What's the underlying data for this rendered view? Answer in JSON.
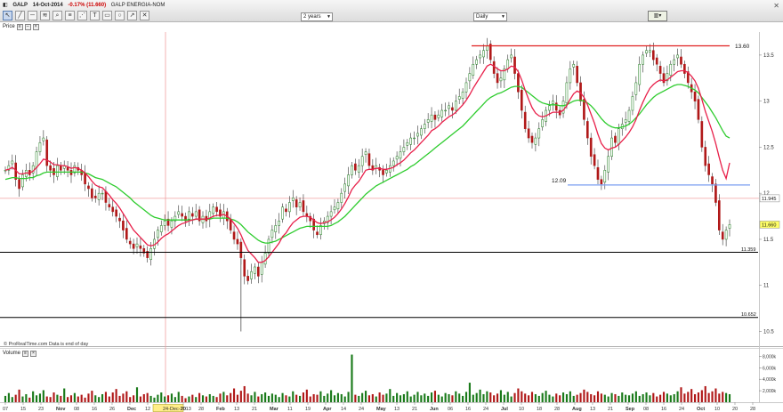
{
  "header": {
    "symbol": "GALP",
    "date": "14-Oct-2014",
    "change": "-0.17% (11.660)",
    "name": "GALP ENERGIA-NOM",
    "period_select": "2 years",
    "interval_select": "Daily"
  },
  "panels": {
    "price_label": "Price",
    "volume_label": "Volume",
    "source_note": "© ProRealTime.com  Data is end of day"
  },
  "colors": {
    "price_up": "#1a7a1a",
    "price_down": "#b01818",
    "ema_short": "#e8204a",
    "ema_long": "#2ecc2e",
    "resistance": "#e02020",
    "support": "#7a9ef0",
    "crosshair": "#f0a0a0",
    "hline": "#000000"
  },
  "chart_data": [
    {
      "type": "candlestick",
      "title": "",
      "ylim": [
        10.35,
        13.75
      ],
      "yticks": [
        10.5,
        11,
        11.5,
        12,
        12.5,
        13,
        13.5
      ],
      "x_tick_labels": [
        "07",
        "15",
        "23",
        "Nov",
        "08",
        "16",
        "26",
        "Dec",
        "12",
        "24-Dec-2013",
        "20",
        "28",
        "Feb",
        "13",
        "21",
        "Mar",
        "11",
        "19",
        "Apr",
        "14",
        "24",
        "May",
        "13",
        "21",
        "Jun",
        "06",
        "16",
        "24",
        "Jul",
        "10",
        "18",
        "28",
        "Aug",
        "13",
        "21",
        "Sep",
        "08",
        "16",
        "24",
        "Oct",
        "10",
        "20",
        "28"
      ],
      "crosshair_date": "24-Dec-2013",
      "crosshair_price": 11.945,
      "last_price": 11.66,
      "annotations": [
        {
          "label": "13.60",
          "value": 13.6,
          "kind": "resistance"
        },
        {
          "label": "12.09",
          "value": 12.09,
          "kind": "support"
        },
        {
          "label": "11.359",
          "value": 11.359,
          "kind": "hline"
        },
        {
          "label": "10.652",
          "value": 10.652,
          "kind": "hline"
        }
      ],
      "price_tags": [
        {
          "label": "11.945",
          "value": 11.945
        },
        {
          "label": "11.660",
          "value": 11.66
        }
      ],
      "grid": false,
      "series": [
        {
          "values": [
            12.25,
            12.3,
            12.35,
            12.15,
            12.05,
            12.2,
            12.25,
            12.2,
            12.3,
            12.45,
            12.55,
            12.6,
            12.3,
            12.25,
            12.2,
            12.3,
            12.25,
            12.3,
            12.25,
            12.2,
            12.3,
            12.25,
            12.2,
            12.1,
            12.05,
            11.95,
            11.95,
            12.0,
            12.0,
            11.9,
            11.85,
            11.8,
            11.75,
            11.7,
            11.6,
            11.5,
            11.45,
            11.4,
            11.45,
            11.4,
            11.35,
            11.3,
            11.4,
            11.5,
            11.6,
            11.65,
            11.7,
            11.65,
            11.7,
            11.75,
            11.8,
            11.75,
            11.7,
            11.8,
            11.75,
            11.8,
            11.7,
            11.75,
            11.7,
            11.8,
            11.85,
            11.8,
            11.75,
            11.8,
            11.7,
            11.6,
            11.5,
            11.45,
            11.3,
            11.1,
            11.05,
            11.15,
            11.2,
            11.1,
            11.25,
            11.35,
            11.5,
            11.6,
            11.65,
            11.7,
            11.85,
            11.8,
            11.9,
            11.95,
            11.85,
            11.9,
            11.8,
            11.75,
            11.7,
            11.6,
            11.55,
            11.65,
            11.7,
            11.75,
            11.8,
            11.85,
            11.9,
            12.0,
            12.1,
            12.2,
            12.3,
            12.25,
            12.3,
            12.4,
            12.45,
            12.3,
            12.25,
            12.3,
            12.25,
            12.2,
            12.25,
            12.3,
            12.35,
            12.4,
            12.45,
            12.5,
            12.55,
            12.6,
            12.6,
            12.65,
            12.7,
            12.75,
            12.8,
            12.85,
            12.8,
            12.85,
            12.9,
            12.9,
            12.95,
            12.9,
            13.0,
            13.05,
            13.1,
            13.2,
            13.3,
            13.4,
            13.45,
            13.5,
            13.55,
            13.6,
            13.45,
            13.3,
            13.2,
            13.25,
            13.35,
            13.45,
            13.5,
            13.3,
            13.1,
            12.9,
            12.7,
            12.6,
            12.55,
            12.6,
            12.7,
            12.8,
            12.9,
            12.95,
            13.0,
            12.9,
            12.85,
            13.0,
            13.2,
            13.35,
            13.4,
            13.2,
            13.0,
            12.8,
            12.6,
            12.4,
            12.3,
            12.15,
            12.1,
            12.25,
            12.4,
            12.6,
            12.55,
            12.7,
            12.75,
            12.8,
            12.9,
            13.05,
            13.2,
            13.4,
            13.5,
            13.55,
            13.55,
            13.45,
            13.4,
            13.3,
            13.2,
            13.3,
            13.4,
            13.45,
            13.5,
            13.4,
            13.3,
            13.2,
            13.1,
            13.0,
            12.8,
            12.5,
            12.3,
            12.2,
            12.1,
            11.9,
            11.6,
            11.5,
            11.6,
            11.66
          ]
        },
        {
          "name": "",
          "values": [
            12.25,
            12.26,
            12.28,
            12.25,
            12.21,
            12.21,
            12.22,
            12.22,
            12.24,
            12.28,
            12.32,
            12.37,
            12.36,
            12.34,
            12.31,
            12.31,
            12.3,
            12.3,
            12.29,
            12.27,
            12.28,
            12.27,
            12.25,
            12.22,
            12.18,
            12.13,
            12.09,
            12.07,
            12.06,
            12.02,
            11.98,
            11.93,
            11.89,
            11.84,
            11.78,
            11.72,
            11.66,
            11.6,
            11.56,
            11.52,
            11.48,
            11.44,
            11.43,
            11.44,
            11.47,
            11.51,
            11.54,
            11.56,
            11.59,
            11.62,
            11.65,
            11.67,
            11.68,
            11.7,
            11.71,
            11.72,
            11.72,
            11.72,
            11.72,
            11.73,
            11.75,
            11.76,
            11.76,
            11.77,
            11.75,
            11.72,
            11.67,
            11.62,
            11.55,
            11.46,
            11.38,
            11.34,
            11.3,
            11.25,
            11.25,
            11.27,
            11.31,
            11.36,
            11.41,
            11.46,
            11.53,
            11.57,
            11.63,
            11.68,
            11.71,
            11.74,
            11.75,
            11.75,
            11.74,
            11.71,
            11.68,
            11.67,
            11.68,
            11.69,
            11.71,
            11.74,
            11.78,
            11.83,
            11.89,
            11.96,
            12.04,
            12.09,
            12.13,
            12.19,
            12.25,
            12.26,
            12.26,
            12.27,
            12.27,
            12.26,
            12.26,
            12.27,
            12.28,
            12.31,
            12.33,
            12.36,
            12.4,
            12.44,
            12.47,
            12.51,
            12.55,
            12.59,
            12.63,
            12.68,
            12.7,
            12.73,
            12.77,
            12.8,
            12.83,
            12.85,
            12.88,
            12.92,
            12.96,
            13.01,
            13.07,
            13.14,
            13.2,
            13.26,
            13.32,
            13.38,
            13.4,
            13.38,
            13.35,
            13.33,
            13.33,
            13.35,
            13.38,
            13.37,
            13.32,
            13.23,
            13.12,
            13.02,
            12.93,
            12.87,
            12.84,
            12.83,
            12.84,
            12.86,
            12.88,
            12.88,
            12.88,
            12.9,
            12.95,
            13.02,
            13.08,
            13.11,
            13.09,
            13.04,
            12.96,
            12.86,
            12.76,
            12.64,
            12.54,
            12.49,
            12.47,
            12.49,
            12.5,
            12.53,
            12.57,
            12.61,
            12.66,
            12.72,
            12.8,
            12.9,
            12.99,
            13.07,
            13.14,
            13.18,
            13.21,
            13.23,
            13.22,
            13.23,
            13.26,
            13.29,
            13.32,
            13.33,
            13.33,
            13.31,
            13.27,
            13.22,
            13.14,
            13.02,
            12.89,
            12.78,
            12.67,
            12.54,
            12.39,
            12.25,
            12.16,
            12.33
          ]
        },
        {
          "name": "",
          "values": [
            12.15,
            12.16,
            12.17,
            12.17,
            12.16,
            12.16,
            12.16,
            12.17,
            12.17,
            12.19,
            12.2,
            12.22,
            12.23,
            12.23,
            12.23,
            12.23,
            12.23,
            12.23,
            12.23,
            12.23,
            12.23,
            12.23,
            12.23,
            12.22,
            12.21,
            12.19,
            12.17,
            12.16,
            12.15,
            12.13,
            12.11,
            12.09,
            12.07,
            12.04,
            12.01,
            11.98,
            11.95,
            11.91,
            11.88,
            11.85,
            11.82,
            11.79,
            11.76,
            11.74,
            11.73,
            11.72,
            11.71,
            11.71,
            11.71,
            11.71,
            11.71,
            11.71,
            11.71,
            11.71,
            11.71,
            11.72,
            11.72,
            11.72,
            11.72,
            11.72,
            11.73,
            11.73,
            11.73,
            11.73,
            11.73,
            11.72,
            11.71,
            11.69,
            11.66,
            11.62,
            11.58,
            11.55,
            11.52,
            11.49,
            11.47,
            11.46,
            11.46,
            11.47,
            11.48,
            11.5,
            11.52,
            11.54,
            11.56,
            11.58,
            11.6,
            11.62,
            11.63,
            11.64,
            11.64,
            11.64,
            11.64,
            11.64,
            11.64,
            11.64,
            11.65,
            11.67,
            11.69,
            11.72,
            11.75,
            11.79,
            11.83,
            11.87,
            11.91,
            11.95,
            11.99,
            12.02,
            12.05,
            12.08,
            12.1,
            12.12,
            12.14,
            12.16,
            12.18,
            12.2,
            12.22,
            12.24,
            12.26,
            12.29,
            12.31,
            12.34,
            12.37,
            12.4,
            12.43,
            12.46,
            12.49,
            12.52,
            12.55,
            12.58,
            12.61,
            12.64,
            12.67,
            12.7,
            12.73,
            12.77,
            12.81,
            12.85,
            12.89,
            12.93,
            12.97,
            13.01,
            13.04,
            13.06,
            13.08,
            13.09,
            13.11,
            13.13,
            13.15,
            13.16,
            13.16,
            13.15,
            13.12,
            13.09,
            13.06,
            13.03,
            13.0,
            12.98,
            12.97,
            12.96,
            12.96,
            12.96,
            12.95,
            12.95,
            12.96,
            12.98,
            13.0,
            13.01,
            13.01,
            13.0,
            12.98,
            12.95,
            12.91,
            12.86,
            12.81,
            12.77,
            12.74,
            12.72,
            12.71,
            12.71,
            12.72,
            12.73,
            12.75,
            12.78,
            12.82,
            12.86,
            12.91,
            12.96,
            13.0,
            13.04,
            13.07,
            13.09,
            13.11,
            13.13,
            13.15,
            13.17,
            13.18,
            13.18,
            13.17,
            13.16,
            13.14,
            13.12,
            13.09,
            13.04,
            12.99,
            12.94,
            12.88,
            12.82,
            12.75,
            12.68,
            12.62,
            12.6
          ]
        }
      ]
    },
    {
      "type": "bar",
      "title": "",
      "ylim": [
        0,
        9000000
      ],
      "yticks": [
        2000000,
        4000000,
        6000000,
        8000000
      ],
      "ytick_labels": [
        "2,000k",
        "4,000k",
        "6,000k",
        "8,000k"
      ],
      "series": [
        {
          "values": [
            1.1,
            1.6,
            0.9,
            1.3,
            2.2,
            1.0,
            1.4,
            0.8,
            1.9,
            1.2,
            1.5,
            2.1,
            1.0,
            0.9,
            1.7,
            1.3,
            1.1,
            2.4,
            0.9,
            1.2,
            1.6,
            1.0,
            1.3,
            0.8,
            1.5,
            2.0,
            1.2,
            0.9,
            1.4,
            1.8,
            1.0,
            1.7,
            2.3,
            1.1,
            1.5,
            1.9,
            0.9,
            1.2,
            2.6,
            1.0,
            1.4,
            1.6,
            1.1,
            0.8,
            1.3,
            1.7,
            1.0,
            1.2,
            1.5,
            0.9,
            1.8,
            1.1,
            0.7,
            1.0,
            1.3,
            0.9,
            1.6,
            1.2,
            1.0,
            1.4,
            1.1,
            0.9,
            1.5,
            1.8,
            1.2,
            1.6,
            2.4,
            1.3,
            2.0,
            2.8,
            1.5,
            1.2,
            1.8,
            1.0,
            1.4,
            1.7,
            1.1,
            1.5,
            1.3,
            0.9,
            1.6,
            1.2,
            1.0,
            1.9,
            1.3,
            1.1,
            1.7,
            2.2,
            1.0,
            1.4,
            1.3,
            1.9,
            1.1,
            1.5,
            2.1,
            1.2,
            1.6,
            1.4,
            1.0,
            1.8,
            8.3,
            1.3,
            1.1,
            1.6,
            2.0,
            1.2,
            1.4,
            1.0,
            1.7,
            1.3,
            1.5,
            2.3,
            1.1,
            1.6,
            1.2,
            1.4,
            1.9,
            1.0,
            1.3,
            1.8,
            1.2,
            1.5,
            1.1,
            1.7,
            2.0,
            1.3,
            1.0,
            1.6,
            1.4,
            1.2,
            1.9,
            1.5,
            1.1,
            1.8,
            3.4,
            1.3,
            1.6,
            2.2,
            1.4,
            1.9,
            1.7,
            1.2,
            1.5,
            2.1,
            1.3,
            1.8,
            1.0,
            1.6,
            2.4,
            1.9,
            1.5,
            1.2,
            1.8,
            1.4,
            1.1,
            1.6,
            2.0,
            1.3,
            1.0,
            1.5,
            1.2,
            1.7,
            1.4,
            1.9,
            1.1,
            1.3,
            1.6,
            2.2,
            1.8,
            1.4,
            1.2,
            1.9,
            1.5,
            1.3,
            1.0,
            1.6,
            1.4,
            1.1,
            1.7,
            1.3,
            1.2,
            1.5,
            1.9,
            1.1,
            1.4,
            1.7,
            1.2,
            1.6,
            1.0,
            1.3,
            1.8,
            1.5,
            1.2,
            1.4,
            1.9,
            2.6,
            1.5,
            1.8,
            2.3,
            1.4,
            1.7,
            2.1,
            2.8,
            1.6,
            1.9,
            2.4,
            1.5,
            1.8,
            1.6,
            1.4
          ]
        }
      ]
    }
  ]
}
